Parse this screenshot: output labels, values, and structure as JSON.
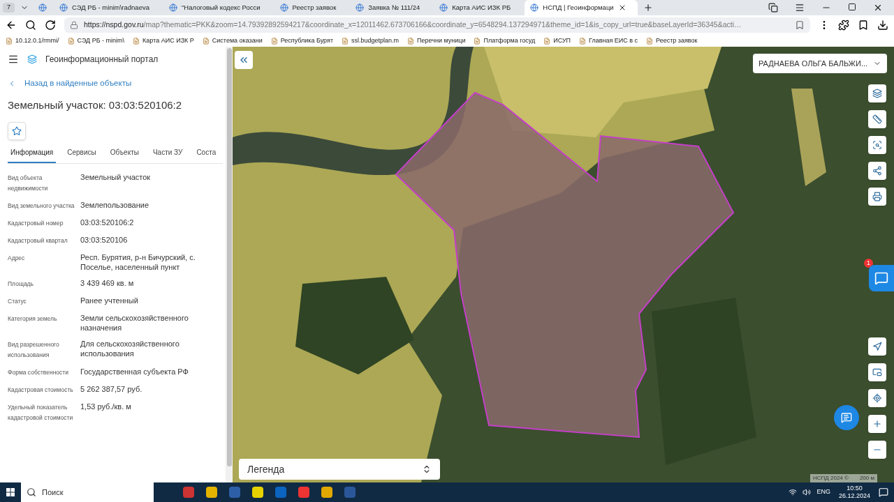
{
  "browser": {
    "tab_count": "7",
    "tabs": [
      {
        "title": "СЭД РБ - minim\\radnaeva",
        "selected": false
      },
      {
        "title": "\"Налоговый кодекс Росси",
        "selected": false
      },
      {
        "title": "Реестр заявок",
        "selected": false
      },
      {
        "title": "Заявка № 111/24",
        "selected": false
      },
      {
        "title": "Карта АИС ИЗК РБ",
        "selected": false
      },
      {
        "title": "НСПД | Геоинформаци",
        "selected": true
      }
    ],
    "url_host": "https://nspd.gov.ru",
    "url_rest": "/map?thematic=PKK&zoom=14.79392892594217&coordinate_x=12011462.673706166&coordinate_y=6548294.137294971&theme_id=1&is_copy_url=true&baseLayerId=36345&acti…",
    "bookmarks": [
      "10.12.0.1/rmmi/",
      "СЭД РБ - minim\\",
      "Карта АИС ИЗК Р",
      "Система оказани",
      "Республика Бурят",
      "ssl.budgetplan.m",
      "Перечни муници",
      "Платформа госуд",
      "ИСУП",
      "Главная ЕИС в с",
      "Реестр заявок"
    ]
  },
  "portal": {
    "title": "Геоинформационный портал",
    "back_link": "Назад в найденные объекты",
    "heading": "Земельный участок: 03:03:520106:2",
    "tabs": [
      {
        "label": "Информация",
        "selected": true
      },
      {
        "label": "Сервисы",
        "selected": false
      },
      {
        "label": "Объекты",
        "selected": false
      },
      {
        "label": "Части ЗУ",
        "selected": false
      },
      {
        "label": "Соста",
        "selected": false
      }
    ],
    "fields": [
      {
        "label": "Вид объекта недвижимости",
        "value": "Земельный участок"
      },
      {
        "label": "Вид земельного участка",
        "value": "Землепользование"
      },
      {
        "label": "Кадастровый номер",
        "value": "03:03:520106:2"
      },
      {
        "label": "Кадастровый квартал",
        "value": "03:03:520106"
      },
      {
        "label": "Адрес",
        "value": "Респ. Бурятия, р-н Бичурский, с. Поселье, населенный пункт"
      },
      {
        "label": "Площадь",
        "value": "3 439 469 кв. м"
      },
      {
        "label": "Статус",
        "value": "Ранее учтенный"
      },
      {
        "label": "Категория земель",
        "value": "Земли сельскохозяйственного назначения"
      },
      {
        "label": "Вид разрешенного использования",
        "value": "Для сельскохозяйственного использования"
      },
      {
        "label": "Форма собственности",
        "value": "Государственная субъекта РФ"
      },
      {
        "label": "Кадастровая стоимость",
        "value": "5 262 387,57 руб."
      },
      {
        "label": "Удельный показатель кадастровой стоимости",
        "value": "1,53 руб./кв. м"
      }
    ]
  },
  "map": {
    "user": "РАДНАЕВА ОЛЬГА БАЛЬЖИ...",
    "legend": "Легенда",
    "notification_badge": "1",
    "copyright": "НСПД 2024 ©",
    "scale": "200 м"
  },
  "taskbar": {
    "search": "Поиск",
    "language": "ENG",
    "time": "10:50",
    "date": "26.12.2024"
  }
}
